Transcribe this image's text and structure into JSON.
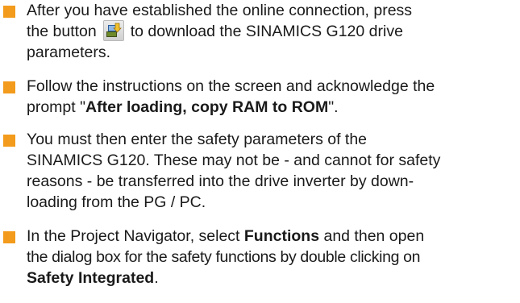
{
  "colors": {
    "bullet": "#f39b1c",
    "text": "#1a1a1a"
  },
  "icons": {
    "download": "download-to-device-icon"
  },
  "items": [
    {
      "line1": "After you have established the online connection, press",
      "line2_before": "the button",
      "line2_after": "to download the SINAMICS G120 drive",
      "line3": "parameters."
    },
    {
      "line1": "Follow the instructions on the screen and acknowledge the",
      "line2_before": "prompt \"",
      "line2_bold": "After loading, copy RAM to ROM",
      "line2_after": "\"."
    },
    {
      "line1": "You must then enter the safety parameters of the",
      "line2": "SINAMICS G120. These may not be - and cannot for safety",
      "line3": "reasons - be transferred into the drive inverter by down-",
      "line4": "loading from the PG / PC."
    },
    {
      "line1_before": "In the Project Navigator, select ",
      "line1_bold": "Functions",
      "line1_after": " and then open",
      "line2": "the dialog box for the safety functions by double clicking on",
      "line3_bold": "Safety Integrated",
      "line3_after": "."
    }
  ]
}
